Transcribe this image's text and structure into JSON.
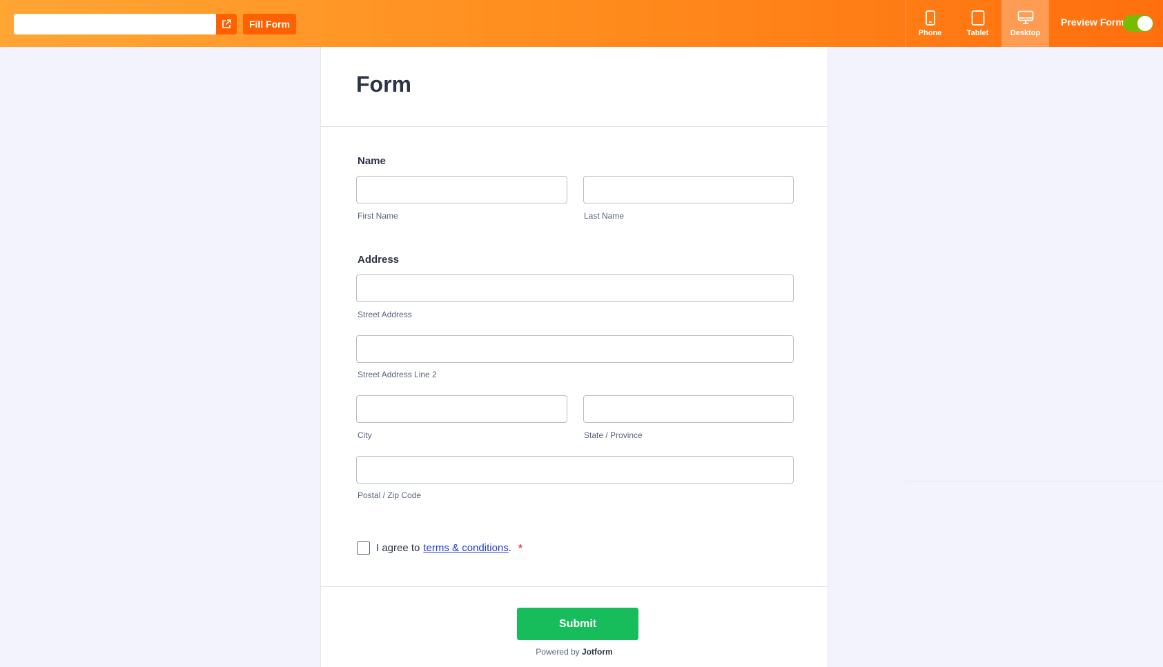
{
  "topbar": {
    "url_value": "",
    "fill_form_label": "Fill Form",
    "devices": [
      {
        "label": "Phone",
        "icon": "phone-icon"
      },
      {
        "label": "Tablet",
        "icon": "tablet-icon"
      },
      {
        "label": "Desktop",
        "icon": "desktop-icon",
        "active": true
      }
    ],
    "preview_label": "Preview Form",
    "preview_on": true,
    "accent": "#ff6100"
  },
  "form": {
    "title": "Form",
    "name_label": "Name",
    "first_name_sublabel": "First Name",
    "last_name_sublabel": "Last Name",
    "address_label": "Address",
    "street_sublabel": "Street Address",
    "street2_sublabel": "Street Address Line 2",
    "city_sublabel": "City",
    "state_sublabel": "State / Province",
    "postal_sublabel": "Postal / Zip Code",
    "agree_text": "I agree to",
    "terms_link": "terms & conditions",
    "agree_suffix": ".",
    "required_mark": "*",
    "submit_label": "Submit",
    "powered_prefix": "Powered by",
    "powered_brand": "Jotform"
  }
}
